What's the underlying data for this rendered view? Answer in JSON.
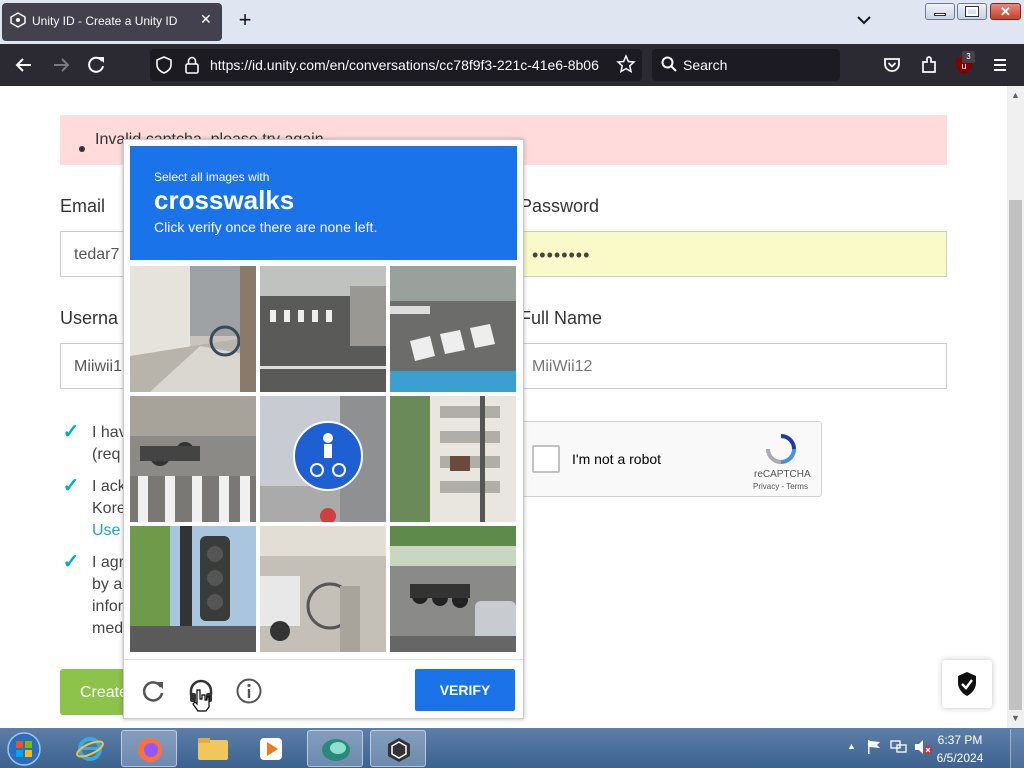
{
  "browser": {
    "tab_title": "Unity ID - Create a Unity ID",
    "url": "https://id.unity.com/en/conversations/cc78f9f3-221c-41e6-8b06",
    "search_placeholder": "Search",
    "extension_badge": "3"
  },
  "form": {
    "error": "Invalid captcha, please try again.",
    "email_label": "Email",
    "email_value": "tedar7",
    "password_label": "Password",
    "password_value": "••••••••",
    "username_label": "Userna",
    "username_value": "Miiwii1",
    "fullname_label": "Full Name",
    "fullname_value": "MiiWii12",
    "consents": [
      {
        "checked": true,
        "lines": [
          "I hav",
          "(req"
        ]
      },
      {
        "checked": true,
        "lines": [
          "I ack",
          "Kore",
          "Use"
        ]
      },
      {
        "checked": true,
        "lines": [
          "I agr",
          "by a",
          "infor",
          "med"
        ]
      }
    ],
    "create_button": "Create"
  },
  "recaptcha_widget": {
    "label": "I'm not a robot",
    "brand": "reCAPTCHA",
    "links": "Privacy - Terms"
  },
  "challenge": {
    "line1": "Select all images with",
    "keyword": "crosswalks",
    "line3": "Click verify once there are none left.",
    "verify": "VERIFY",
    "tiles": [
      "sidewalk-bicycle",
      "street-crosswalk",
      "intersection-crosswalk",
      "parked-scooters-crosswalk",
      "bicycle-pedestrian-sign",
      "apartment-building",
      "traffic-light",
      "bicycle-scooter",
      "street-parked-scooters"
    ]
  },
  "taskbar": {
    "time": "6:37 PM",
    "date": "6/5/2024"
  }
}
